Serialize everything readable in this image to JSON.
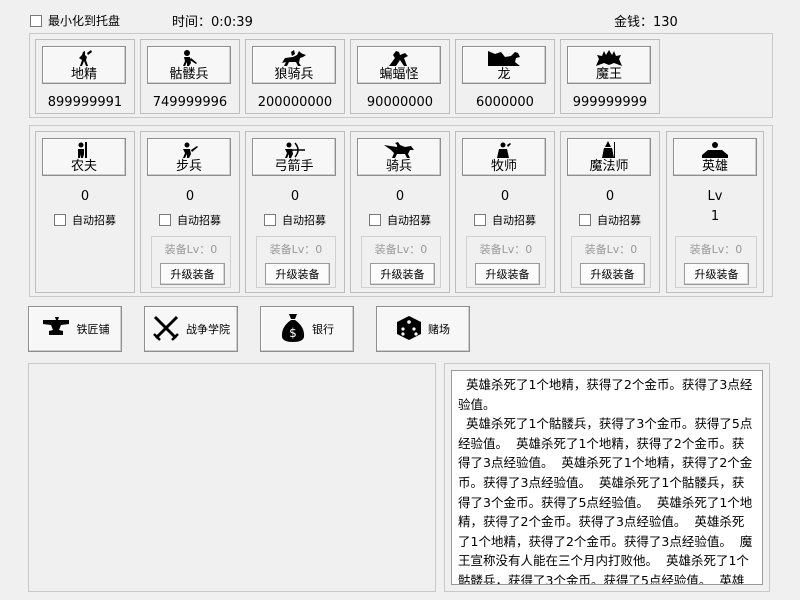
{
  "top": {
    "minimize_label": "最小化到托盘",
    "time_label": "时间：0:0:39",
    "gold_label": "金钱：130"
  },
  "enemies": [
    {
      "name": "地精",
      "count": "899999991",
      "icon": "goblin-icon"
    },
    {
      "name": "骷髅兵",
      "count": "749999996",
      "icon": "skeleton-icon"
    },
    {
      "name": "狼骑兵",
      "count": "200000000",
      "icon": "wolf-rider-icon"
    },
    {
      "name": "蝙蝠怪",
      "count": "90000000",
      "icon": "bat-monster-icon"
    },
    {
      "name": "龙",
      "count": "6000000",
      "icon": "dragon-icon"
    },
    {
      "name": "魔王",
      "count": "999999999",
      "icon": "demon-king-icon"
    }
  ],
  "units": [
    {
      "name": "农夫",
      "count": "0",
      "auto": "自动招募",
      "icon": "farmer-icon"
    },
    {
      "name": "步兵",
      "count": "0",
      "auto": "自动招募",
      "equip_lv": "装备Lv：0",
      "upgrade": "升级装备",
      "icon": "infantry-icon"
    },
    {
      "name": "弓箭手",
      "count": "0",
      "auto": "自动招募",
      "equip_lv": "装备Lv：0",
      "upgrade": "升级装备",
      "icon": "archer-icon"
    },
    {
      "name": "骑兵",
      "count": "0",
      "auto": "自动招募",
      "equip_lv": "装备Lv：0",
      "upgrade": "升级装备",
      "icon": "cavalry-icon"
    },
    {
      "name": "牧师",
      "count": "0",
      "auto": "自动招募",
      "equip_lv": "装备Lv：0",
      "upgrade": "升级装备",
      "icon": "priest-icon"
    },
    {
      "name": "魔法师",
      "count": "0",
      "auto": "自动招募",
      "equip_lv": "装备Lv：0",
      "upgrade": "升级装备",
      "icon": "mage-icon"
    }
  ],
  "hero": {
    "name": "英雄",
    "lv_label": "Lv",
    "lv_value": "1",
    "equip_lv": "装备Lv：0",
    "upgrade": "升级装备",
    "icon": "hero-icon"
  },
  "actions": [
    {
      "label": "铁匠铺",
      "icon": "anvil-icon"
    },
    {
      "label": "战争学院",
      "icon": "crossed-swords-icon"
    },
    {
      "label": "银行",
      "icon": "money-bag-icon"
    },
    {
      "label": "赌场",
      "icon": "dice-icon"
    }
  ],
  "log": {
    "text": "  英雄杀死了1个地精，获得了2个金币。获得了3点经验值。\n  英雄杀死了1个骷髅兵，获得了3个金币。获得了5点经验值。  英雄杀死了1个地精，获得了2个金币。获得了3点经验值。  英雄杀死了1个地精，获得了2个金币。获得了3点经验值。  英雄杀死了1个骷髅兵，获得了3个金币。获得了5点经验值。  英雄杀死了1个地精，获得了2个金币。获得了3点经验值。  英雄杀死了1个地精，获得了2个金币。获得了3点经验值。  魔王宣称没有人能在三个月内打败他。  英雄杀死了1个骷髅兵，获得了3个金币。获得了5点经验值。  英雄"
  }
}
